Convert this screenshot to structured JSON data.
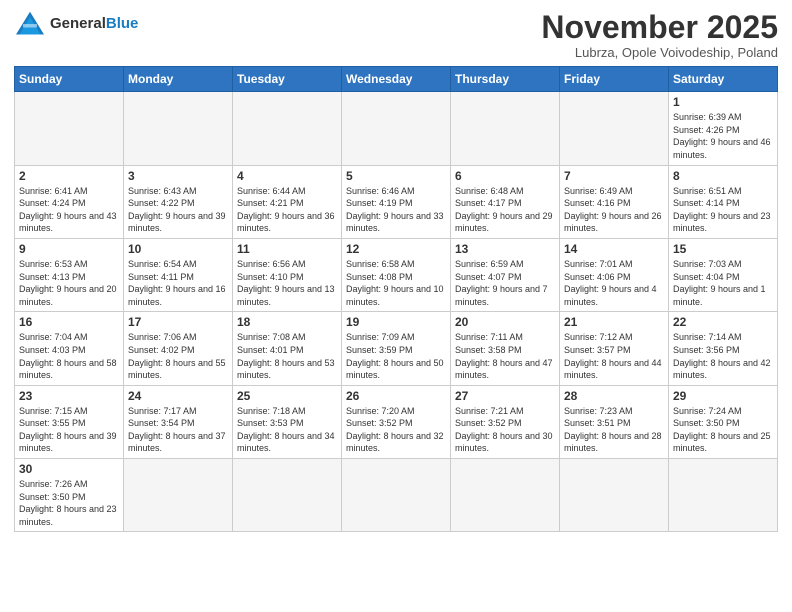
{
  "logo": {
    "text_general": "General",
    "text_blue": "Blue"
  },
  "header": {
    "title": "November 2025",
    "subtitle": "Lubrza, Opole Voivodeship, Poland"
  },
  "weekdays": [
    "Sunday",
    "Monday",
    "Tuesday",
    "Wednesday",
    "Thursday",
    "Friday",
    "Saturday"
  ],
  "weeks": [
    [
      {
        "day": "",
        "info": ""
      },
      {
        "day": "",
        "info": ""
      },
      {
        "day": "",
        "info": ""
      },
      {
        "day": "",
        "info": ""
      },
      {
        "day": "",
        "info": ""
      },
      {
        "day": "",
        "info": ""
      },
      {
        "day": "1",
        "info": "Sunrise: 6:39 AM\nSunset: 4:26 PM\nDaylight: 9 hours and 46 minutes."
      }
    ],
    [
      {
        "day": "2",
        "info": "Sunrise: 6:41 AM\nSunset: 4:24 PM\nDaylight: 9 hours and 43 minutes."
      },
      {
        "day": "3",
        "info": "Sunrise: 6:43 AM\nSunset: 4:22 PM\nDaylight: 9 hours and 39 minutes."
      },
      {
        "day": "4",
        "info": "Sunrise: 6:44 AM\nSunset: 4:21 PM\nDaylight: 9 hours and 36 minutes."
      },
      {
        "day": "5",
        "info": "Sunrise: 6:46 AM\nSunset: 4:19 PM\nDaylight: 9 hours and 33 minutes."
      },
      {
        "day": "6",
        "info": "Sunrise: 6:48 AM\nSunset: 4:17 PM\nDaylight: 9 hours and 29 minutes."
      },
      {
        "day": "7",
        "info": "Sunrise: 6:49 AM\nSunset: 4:16 PM\nDaylight: 9 hours and 26 minutes."
      },
      {
        "day": "8",
        "info": "Sunrise: 6:51 AM\nSunset: 4:14 PM\nDaylight: 9 hours and 23 minutes."
      }
    ],
    [
      {
        "day": "9",
        "info": "Sunrise: 6:53 AM\nSunset: 4:13 PM\nDaylight: 9 hours and 20 minutes."
      },
      {
        "day": "10",
        "info": "Sunrise: 6:54 AM\nSunset: 4:11 PM\nDaylight: 9 hours and 16 minutes."
      },
      {
        "day": "11",
        "info": "Sunrise: 6:56 AM\nSunset: 4:10 PM\nDaylight: 9 hours and 13 minutes."
      },
      {
        "day": "12",
        "info": "Sunrise: 6:58 AM\nSunset: 4:08 PM\nDaylight: 9 hours and 10 minutes."
      },
      {
        "day": "13",
        "info": "Sunrise: 6:59 AM\nSunset: 4:07 PM\nDaylight: 9 hours and 7 minutes."
      },
      {
        "day": "14",
        "info": "Sunrise: 7:01 AM\nSunset: 4:06 PM\nDaylight: 9 hours and 4 minutes."
      },
      {
        "day": "15",
        "info": "Sunrise: 7:03 AM\nSunset: 4:04 PM\nDaylight: 9 hours and 1 minute."
      }
    ],
    [
      {
        "day": "16",
        "info": "Sunrise: 7:04 AM\nSunset: 4:03 PM\nDaylight: 8 hours and 58 minutes."
      },
      {
        "day": "17",
        "info": "Sunrise: 7:06 AM\nSunset: 4:02 PM\nDaylight: 8 hours and 55 minutes."
      },
      {
        "day": "18",
        "info": "Sunrise: 7:08 AM\nSunset: 4:01 PM\nDaylight: 8 hours and 53 minutes."
      },
      {
        "day": "19",
        "info": "Sunrise: 7:09 AM\nSunset: 3:59 PM\nDaylight: 8 hours and 50 minutes."
      },
      {
        "day": "20",
        "info": "Sunrise: 7:11 AM\nSunset: 3:58 PM\nDaylight: 8 hours and 47 minutes."
      },
      {
        "day": "21",
        "info": "Sunrise: 7:12 AM\nSunset: 3:57 PM\nDaylight: 8 hours and 44 minutes."
      },
      {
        "day": "22",
        "info": "Sunrise: 7:14 AM\nSunset: 3:56 PM\nDaylight: 8 hours and 42 minutes."
      }
    ],
    [
      {
        "day": "23",
        "info": "Sunrise: 7:15 AM\nSunset: 3:55 PM\nDaylight: 8 hours and 39 minutes."
      },
      {
        "day": "24",
        "info": "Sunrise: 7:17 AM\nSunset: 3:54 PM\nDaylight: 8 hours and 37 minutes."
      },
      {
        "day": "25",
        "info": "Sunrise: 7:18 AM\nSunset: 3:53 PM\nDaylight: 8 hours and 34 minutes."
      },
      {
        "day": "26",
        "info": "Sunrise: 7:20 AM\nSunset: 3:52 PM\nDaylight: 8 hours and 32 minutes."
      },
      {
        "day": "27",
        "info": "Sunrise: 7:21 AM\nSunset: 3:52 PM\nDaylight: 8 hours and 30 minutes."
      },
      {
        "day": "28",
        "info": "Sunrise: 7:23 AM\nSunset: 3:51 PM\nDaylight: 8 hours and 28 minutes."
      },
      {
        "day": "29",
        "info": "Sunrise: 7:24 AM\nSunset: 3:50 PM\nDaylight: 8 hours and 25 minutes."
      }
    ],
    [
      {
        "day": "30",
        "info": "Sunrise: 7:26 AM\nSunset: 3:50 PM\nDaylight: 8 hours and 23 minutes."
      },
      {
        "day": "",
        "info": ""
      },
      {
        "day": "",
        "info": ""
      },
      {
        "day": "",
        "info": ""
      },
      {
        "day": "",
        "info": ""
      },
      {
        "day": "",
        "info": ""
      },
      {
        "day": "",
        "info": ""
      }
    ]
  ]
}
